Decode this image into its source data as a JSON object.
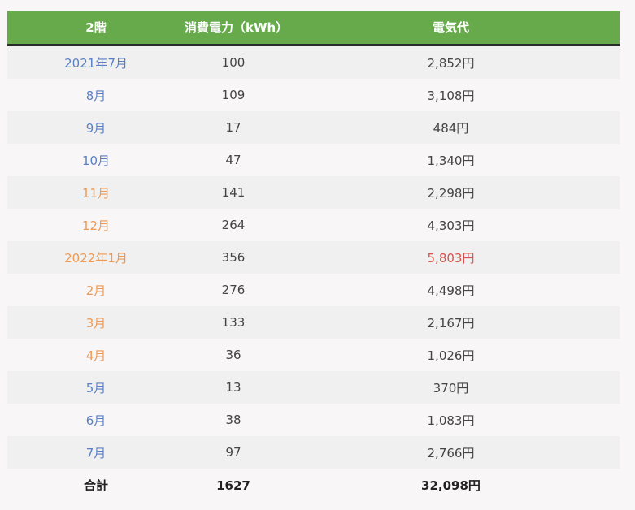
{
  "header": {
    "col1": "2階",
    "col2": "消費電力（kWh）",
    "col3": "電気代"
  },
  "rows": [
    {
      "month": "2021年7月",
      "kwh": "100",
      "cost": "2,852円",
      "month_color": "blue",
      "cost_color": "normal"
    },
    {
      "month": "8月",
      "kwh": "109",
      "cost": "3,108円",
      "month_color": "blue",
      "cost_color": "normal"
    },
    {
      "month": "9月",
      "kwh": "17",
      "cost": "484円",
      "month_color": "blue",
      "cost_color": "normal"
    },
    {
      "month": "10月",
      "kwh": "47",
      "cost": "1,340円",
      "month_color": "blue",
      "cost_color": "normal"
    },
    {
      "month": "11月",
      "kwh": "141",
      "cost": "2,298円",
      "month_color": "orange",
      "cost_color": "normal"
    },
    {
      "month": "12月",
      "kwh": "264",
      "cost": "4,303円",
      "month_color": "orange",
      "cost_color": "normal"
    },
    {
      "month": "2022年1月",
      "kwh": "356",
      "cost": "5,803円",
      "month_color": "orange",
      "cost_color": "red"
    },
    {
      "month": "2月",
      "kwh": "276",
      "cost": "4,498円",
      "month_color": "orange",
      "cost_color": "normal"
    },
    {
      "month": "3月",
      "kwh": "133",
      "cost": "2,167円",
      "month_color": "orange",
      "cost_color": "normal"
    },
    {
      "month": "4月",
      "kwh": "36",
      "cost": "1,026円",
      "month_color": "orange",
      "cost_color": "normal"
    },
    {
      "month": "5月",
      "kwh": "13",
      "cost": "370円",
      "month_color": "blue",
      "cost_color": "normal"
    },
    {
      "month": "6月",
      "kwh": "38",
      "cost": "1,083円",
      "month_color": "blue",
      "cost_color": "normal"
    },
    {
      "month": "7月",
      "kwh": "97",
      "cost": "2,766円",
      "month_color": "blue",
      "cost_color": "normal"
    }
  ],
  "total": {
    "label": "合計",
    "kwh": "1627",
    "cost": "32,098円"
  },
  "colors": {
    "header_bg": "#66aa4c",
    "month_blue": "#5a7fc4",
    "month_orange": "#ec9a56",
    "cost_red": "#d9534f"
  }
}
